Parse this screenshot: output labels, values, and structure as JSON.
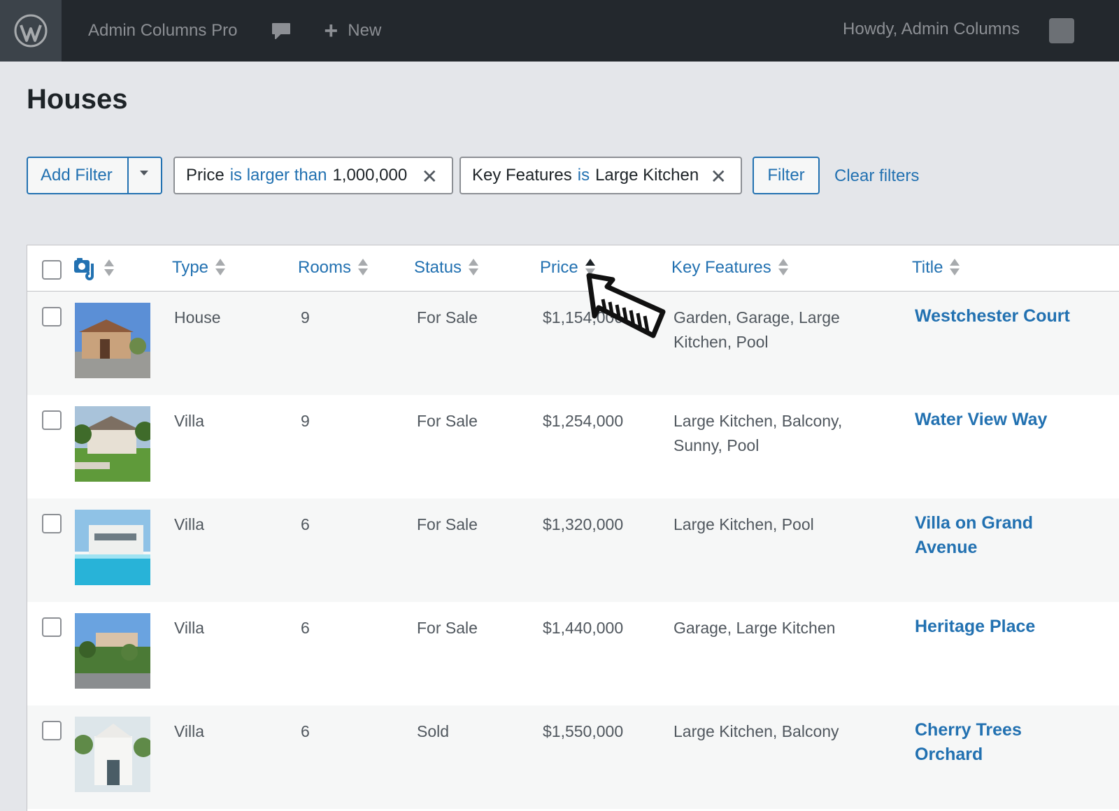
{
  "adminbar": {
    "site_name": "Admin Columns Pro",
    "new_label": "New",
    "howdy": "Howdy,  Admin Columns"
  },
  "page": {
    "title": "Houses"
  },
  "filters": {
    "add_filter_label": "Add Filter",
    "chips": [
      {
        "field": "Price",
        "operator": "is larger than",
        "value": "1,000,000"
      },
      {
        "field": "Key Features",
        "operator": "is",
        "value": "Large Kitchen"
      }
    ],
    "filter_button": "Filter",
    "clear_link": "Clear filters"
  },
  "table": {
    "columns": {
      "type": "Type",
      "rooms": "Rooms",
      "status": "Status",
      "price": "Price",
      "features": "Key Features",
      "title": "Title"
    },
    "sorted_column": "Price",
    "sort_direction": "asc",
    "rows": [
      {
        "type": "House",
        "rooms": "9",
        "status": "For Sale",
        "price": "$1,154,000",
        "features": "Garden, Garage, Large Kitchen, Pool",
        "title": "Westchester Court"
      },
      {
        "type": "Villa",
        "rooms": "9",
        "status": "For Sale",
        "price": "$1,254,000",
        "features": "Large Kitchen, Balcony, Sunny, Pool",
        "title": "Water View Way"
      },
      {
        "type": "Villa",
        "rooms": "6",
        "status": "For Sale",
        "price": "$1,320,000",
        "features": "Large Kitchen, Pool",
        "title": "Villa on Grand Avenue"
      },
      {
        "type": "Villa",
        "rooms": "6",
        "status": "For Sale",
        "price": "$1,440,000",
        "features": "Garage, Large Kitchen",
        "title": "Heritage Place"
      },
      {
        "type": "Villa",
        "rooms": "6",
        "status": "Sold",
        "price": "$1,550,000",
        "features": "Large Kitchen, Balcony",
        "title": "Cherry Trees Orchard"
      }
    ]
  },
  "colors": {
    "accent": "#2271b1",
    "adminbar": "#23282d",
    "page_bg": "#e4e6ea"
  },
  "icons": [
    "wordpress-logo-icon",
    "comment-icon",
    "plus-icon",
    "media-column-icon",
    "sort-icon",
    "close-icon",
    "cursor-arrow-icon"
  ]
}
